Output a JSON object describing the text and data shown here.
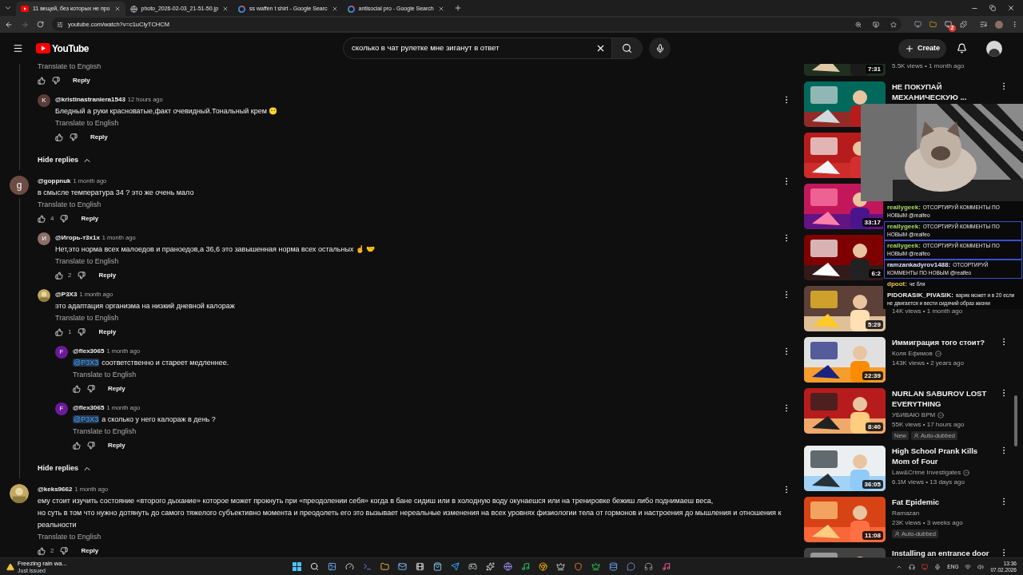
{
  "browser": {
    "tabs": [
      {
        "title": "11 вещей, без которых не про",
        "selected": true,
        "kind": "youtube"
      },
      {
        "title": "photo_2026-02-03_21-51-50.jp",
        "selected": false,
        "kind": "globe"
      },
      {
        "title": "ss waffen t shirt - Google Searc",
        "selected": false,
        "kind": "google"
      },
      {
        "title": "antisocial pro - Google Search",
        "selected": false,
        "kind": "google"
      }
    ],
    "url": "youtube.com/watch?v=c1uClyTCHCM",
    "extension_badge": "2"
  },
  "header": {
    "logo": "YouTube",
    "search": {
      "value": "сколько в чат рулетке мне зиганут в ответ"
    },
    "create": "Create"
  },
  "comments": [
    {
      "translate": "Translate to English",
      "reply": "Reply",
      "hide_replies": "Hide replies",
      "replies": [
        {
          "author": "@kristinastraniera1543",
          "time": "12 hours ago",
          "avatar_letter": "K",
          "color": "#5d3b3b",
          "text": "Бледный а руки красноватые,факт очевидный.Тональный крем 😶",
          "translate": "Translate to English",
          "reply": "Reply"
        }
      ]
    },
    {
      "author": "@goppnuk",
      "time": "1 month ago",
      "avatar_letter": "g",
      "color": "#6d4c45",
      "text": "в смысле температура 34 ? это же очень мало",
      "translate": "Translate to English",
      "likes": "4",
      "reply": "Reply",
      "hide_replies": "Hide replies",
      "replies": [
        {
          "author": "@Игорь-т3х1х",
          "time": "1 month ago",
          "avatar_letter": "И",
          "color": "#8a6f68",
          "text": "Нет,это норма всех малоедов и праноедов,а 36,6 это завышенная норма всех остальных ☝ 🤝",
          "translate": "Translate to English",
          "likes": "2",
          "reply": "Reply"
        },
        {
          "author": "@P3X3",
          "time": "1 month ago",
          "text": "это адаптация организма на низкий дневной калораж",
          "translate": "Translate to English",
          "likes": "1",
          "reply": "Reply",
          "replies": [
            {
              "author": "@flex3065",
              "time": "1 month ago",
              "avatar_letter": "F",
              "color": "#6a1b9a",
              "mention": "@P3X3",
              "text": "соответственно и стареет медленнее.",
              "translate": "Translate to English",
              "reply": "Reply"
            },
            {
              "author": "@flex3065",
              "time": "1 month ago",
              "avatar_letter": "F",
              "color": "#6a1b9a",
              "mention": "@P3X3",
              "text": "а сколько у него калораж в день ?",
              "translate": "Translate to English",
              "reply": "Reply"
            }
          ]
        }
      ]
    },
    {
      "author": "@keks9662",
      "time": "1 month ago",
      "text": "ему стоит изучить состояние «второго дыхание» которое может прокнуть при «преодолении себя» когда в бане сидиш или в холодную воду окунаешся или на тренировке бежиш либо поднимаеш веса,\nно суть в том что нужно дотянуть до самого тяжелого субъективно момента и преодолеть его это вызывает нереальные изменения на всех уровнях физиологии тела от гормонов и настроения до мышления и отношения к реальности",
      "translate": "Translate to English",
      "likes": "2",
      "reply": "Reply"
    }
  ],
  "sidebar": [
    {
      "kind": "cut",
      "meta": "5.5K views • 1 month ago",
      "duration": "7:31"
    },
    {
      "kind": "video",
      "title": "НЕ ПОКУПАЙ МЕХАНИЧЕСКУЮ ..."
    },
    {
      "kind": "video"
    },
    {
      "kind": "video",
      "duration": "33:17"
    },
    {
      "kind": "video",
      "duration": "6:2"
    },
    {
      "kind": "covered",
      "meta": "14K views • 1 month ago",
      "duration": "5:29"
    },
    {
      "kind": "video",
      "title": "Иммиграция того стоит?",
      "channel": "Коля Ефимов",
      "verified": true,
      "meta": "143K views • 2 years ago",
      "duration": "22:39"
    },
    {
      "kind": "video",
      "title": "NURLAN SABUROV LOST EVERYTHING",
      "channel": "УБИВАЮ ВРМ",
      "verified": true,
      "meta": "55K views • 17 hours ago",
      "duration": "8:40",
      "badges": [
        {
          "label": "New",
          "kind": "plain"
        },
        {
          "label": "Auto-dubbed",
          "kind": "dubbed"
        }
      ]
    },
    {
      "kind": "video",
      "title": "High School Prank Kills Mom of Four",
      "channel": "Law&Crime Investigates",
      "verified": true,
      "meta": "6.1M views • 13 days ago",
      "duration": "36:05"
    },
    {
      "kind": "video",
      "title": "Fat Epidemic",
      "channel": "Ramazan",
      "meta": "23K views • 3 weeks ago",
      "duration": "11:08",
      "badges": [
        {
          "label": "Auto-dubbed",
          "kind": "dubbed"
        }
      ]
    },
    {
      "kind": "video",
      "title": "Installing an entrance door"
    }
  ],
  "overlay": {
    "chat": [
      {
        "user": "reallygeek:",
        "color": "#a6d96a",
        "text": "ОТСОРТИРУЙ КОММЕНТЫ ПО НОВЫМ @realfeo",
        "highlighted": false
      },
      {
        "user": "reallygeek:",
        "color": "#a6d96a",
        "text": "ОТСОРТИРУЙ КОММЕНТЫ ПО НОВЫМ @realfeo",
        "highlighted": true
      },
      {
        "user": "reallygeek:",
        "color": "#a6d96a",
        "text": "ОТСОРТИРУЙ КОММЕНТЫ ПО НОВЫМ @realfeo",
        "highlighted": true
      },
      {
        "user": "ramzankadyrov1488:",
        "color": "#dde3ff",
        "text": "ОТСОРТИРУЙ КОММЕНТЫ ПО НОВЫМ @realfeo",
        "highlighted": true
      },
      {
        "user": "dpoot:",
        "color": "#e6c84a",
        "text": "че бля",
        "highlighted": false
      },
      {
        "user": "PIDORASIK_PIVASIK:",
        "color": "#f0f0f0",
        "text": "варик может и в 20 если не двигается и вести сидячий образ жизни",
        "highlighted": false
      }
    ]
  },
  "taskbar": {
    "weather": {
      "title": "Freezing rain wa...",
      "subtitle": "Just issued"
    },
    "language": "ENG",
    "time": "13:36",
    "date": "07.02.2026"
  }
}
